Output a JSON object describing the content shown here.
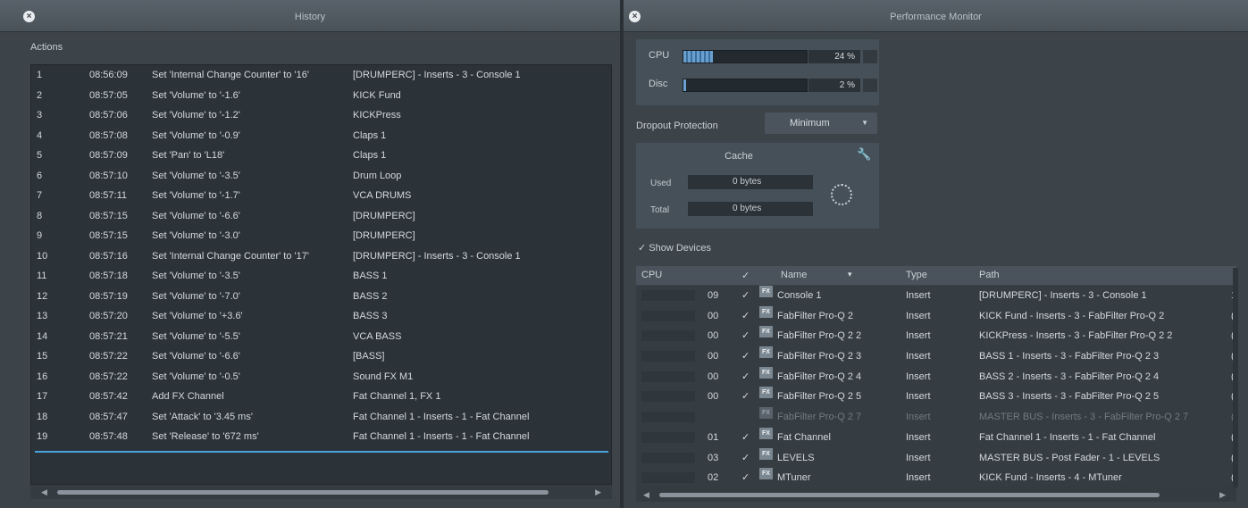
{
  "history": {
    "title": "History",
    "actions_label": "Actions",
    "rows": [
      {
        "num": "1",
        "time": "08:56:09",
        "action": "Set 'Internal Change Counter' to '16'",
        "target": "[DRUMPERC] - Inserts - 3 - Console 1"
      },
      {
        "num": "2",
        "time": "08:57:05",
        "action": "Set 'Volume' to '-1.6'",
        "target": "KICK Fund"
      },
      {
        "num": "3",
        "time": "08:57:06",
        "action": "Set 'Volume' to '-1.2'",
        "target": "KICKPress"
      },
      {
        "num": "4",
        "time": "08:57:08",
        "action": "Set 'Volume' to '-0.9'",
        "target": "Claps 1"
      },
      {
        "num": "5",
        "time": "08:57:09",
        "action": "Set 'Pan' to 'L18'",
        "target": "Claps 1"
      },
      {
        "num": "6",
        "time": "08:57:10",
        "action": "Set 'Volume' to '-3.5'",
        "target": "Drum Loop"
      },
      {
        "num": "7",
        "time": "08:57:11",
        "action": "Set 'Volume' to '-1.7'",
        "target": "VCA DRUMS"
      },
      {
        "num": "8",
        "time": "08:57:15",
        "action": "Set 'Volume' to '-6.6'",
        "target": "[DRUMPERC]"
      },
      {
        "num": "9",
        "time": "08:57:15",
        "action": "Set 'Volume' to '-3.0'",
        "target": "[DRUMPERC]"
      },
      {
        "num": "10",
        "time": "08:57:16",
        "action": "Set 'Internal Change Counter' to '17'",
        "target": "[DRUMPERC] - Inserts - 3 - Console 1"
      },
      {
        "num": "11",
        "time": "08:57:18",
        "action": "Set 'Volume' to '-3.5'",
        "target": "BASS 1"
      },
      {
        "num": "12",
        "time": "08:57:19",
        "action": "Set 'Volume' to '-7.0'",
        "target": "BASS 2"
      },
      {
        "num": "13",
        "time": "08:57:20",
        "action": "Set 'Volume' to '+3.6'",
        "target": "BASS 3"
      },
      {
        "num": "14",
        "time": "08:57:21",
        "action": "Set 'Volume' to '-5.5'",
        "target": "VCA BASS"
      },
      {
        "num": "15",
        "time": "08:57:22",
        "action": "Set 'Volume' to '-6.6'",
        "target": "[BASS]"
      },
      {
        "num": "16",
        "time": "08:57:22",
        "action": "Set 'Volume' to '-0.5'",
        "target": "Sound FX M1"
      },
      {
        "num": "17",
        "time": "08:57:42",
        "action": "Add FX Channel",
        "target": "Fat Channel 1, FX 1"
      },
      {
        "num": "18",
        "time": "08:57:47",
        "action": "Set 'Attack' to '3.45 ms'",
        "target": "Fat Channel 1 - Inserts - 1 - Fat Channel"
      },
      {
        "num": "19",
        "time": "08:57:48",
        "action": "Set 'Release' to '672 ms'",
        "target": "Fat Channel 1 - Inserts - 1 - Fat Channel"
      }
    ]
  },
  "perf": {
    "title": "Performance Monitor",
    "cpu": {
      "label": "CPU",
      "value": "24 %",
      "fraction": 0.24
    },
    "disc": {
      "label": "Disc",
      "value": "2 %",
      "fraction": 0.02
    },
    "dropout": {
      "label": "Dropout Protection",
      "value": "Minimum"
    },
    "cache": {
      "title": "Cache",
      "used_label": "Used",
      "used_value": "0 bytes",
      "total_label": "Total",
      "total_value": "0 bytes"
    },
    "show_devices_label": "Show Devices",
    "columns": {
      "cpu": "CPU",
      "name": "Name",
      "type": "Type",
      "path": "Path"
    },
    "devices": [
      {
        "cpu": "09",
        "checked": true,
        "name": "Console 1",
        "type": "Insert",
        "path": "[DRUMPERC] - Inserts - 3 - Console 1",
        "end": "1",
        "active": true
      },
      {
        "cpu": "00",
        "checked": true,
        "name": "FabFilter Pro-Q 2",
        "type": "Insert",
        "path": "KICK Fund - Inserts - 3 - FabFilter Pro-Q 2",
        "end": "(",
        "active": true
      },
      {
        "cpu": "00",
        "checked": true,
        "name": "FabFilter Pro-Q 2 2",
        "type": "Insert",
        "path": "KICKPress - Inserts - 3 - FabFilter Pro-Q 2 2",
        "end": "(",
        "active": true
      },
      {
        "cpu": "00",
        "checked": true,
        "name": "FabFilter Pro-Q 2 3",
        "type": "Insert",
        "path": "BASS 1 - Inserts - 3 - FabFilter Pro-Q 2 3",
        "end": "(",
        "active": true
      },
      {
        "cpu": "00",
        "checked": true,
        "name": "FabFilter Pro-Q 2 4",
        "type": "Insert",
        "path": "BASS 2 - Inserts - 3 - FabFilter Pro-Q 2 4",
        "end": "(",
        "active": true
      },
      {
        "cpu": "00",
        "checked": true,
        "name": "FabFilter Pro-Q 2 5",
        "type": "Insert",
        "path": "BASS 3 - Inserts - 3 - FabFilter Pro-Q 2 5",
        "end": "(",
        "active": true
      },
      {
        "cpu": "",
        "checked": false,
        "name": "FabFilter Pro-Q 2 7",
        "type": "Insert",
        "path": "MASTER BUS - Inserts - 3 - FabFilter Pro-Q 2 7",
        "end": "(",
        "active": false
      },
      {
        "cpu": "01",
        "checked": true,
        "name": "Fat Channel",
        "type": "Insert",
        "path": "Fat Channel 1 - Inserts - 1 - Fat Channel",
        "end": "(",
        "active": true
      },
      {
        "cpu": "03",
        "checked": true,
        "name": "LEVELS",
        "type": "Insert",
        "path": "MASTER BUS - Post Fader - 1 - LEVELS",
        "end": "(",
        "active": true
      },
      {
        "cpu": "02",
        "checked": true,
        "name": "MTuner",
        "type": "Insert",
        "path": "KICK Fund - Inserts - 4 - MTuner",
        "end": "(",
        "active": true
      }
    ]
  }
}
